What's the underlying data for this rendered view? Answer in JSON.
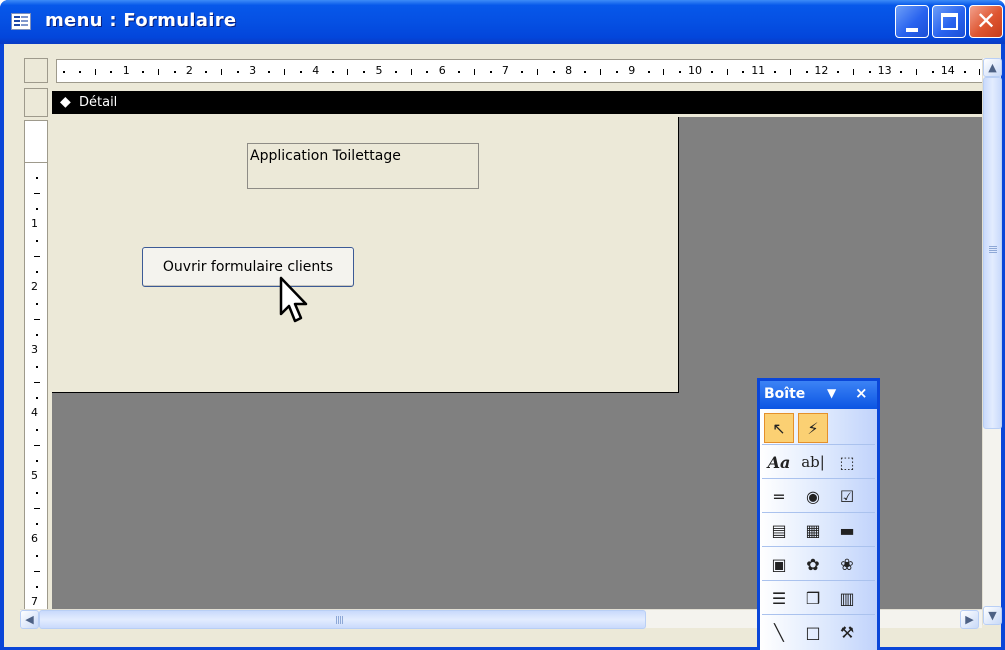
{
  "window": {
    "title": "menu : Formulaire"
  },
  "ruler": {
    "horizontal_labels": [
      "1",
      "2",
      "3",
      "4",
      "5",
      "6",
      "7",
      "8",
      "9",
      "10",
      "11",
      "12",
      "13",
      "14"
    ],
    "vertical_labels": [
      "1",
      "2",
      "3",
      "4",
      "5",
      "6",
      "7"
    ]
  },
  "section": {
    "label": "Détail",
    "arrow": "◆"
  },
  "form": {
    "label_text": "Application Toilettage",
    "button_text": "Ouvrir formulaire clients"
  },
  "toolbox": {
    "title": "Boîte",
    "dropdown_glyph": "▼",
    "close_glyph": "×",
    "tools": [
      {
        "name": "select-objects-icon",
        "glyph": "↖",
        "active": true
      },
      {
        "name": "control-wizards-icon",
        "glyph": "⚡",
        "active": true
      },
      {
        "name": "label-tool-icon",
        "glyph": "Aa",
        "active": false
      },
      {
        "name": "text-box-tool-icon",
        "glyph": "ab|",
        "active": false
      },
      {
        "name": "option-group-tool-icon",
        "glyph": "⬚",
        "active": false
      },
      {
        "name": "toggle-button-tool-icon",
        "glyph": "=",
        "active": false
      },
      {
        "name": "option-button-tool-icon",
        "glyph": "◉",
        "active": false
      },
      {
        "name": "check-box-tool-icon",
        "glyph": "☑",
        "active": false
      },
      {
        "name": "combo-box-tool-icon",
        "glyph": "▤",
        "active": false
      },
      {
        "name": "list-box-tool-icon",
        "glyph": "▦",
        "active": false
      },
      {
        "name": "command-button-tool-icon",
        "glyph": "▬",
        "active": false
      },
      {
        "name": "image-tool-icon",
        "glyph": "▣",
        "active": false
      },
      {
        "name": "unbound-object-frame-icon",
        "glyph": "✿",
        "active": false
      },
      {
        "name": "bound-object-frame-icon",
        "glyph": "❀",
        "active": false
      },
      {
        "name": "page-break-tool-icon",
        "glyph": "☰",
        "active": false
      },
      {
        "name": "tab-control-tool-icon",
        "glyph": "❒",
        "active": false
      },
      {
        "name": "subform-tool-icon",
        "glyph": "▥",
        "active": false
      },
      {
        "name": "line-tool-icon",
        "glyph": "╲",
        "active": false
      },
      {
        "name": "rectangle-tool-icon",
        "glyph": "□",
        "active": false
      },
      {
        "name": "more-controls-icon",
        "glyph": "⚒",
        "active": false
      }
    ]
  },
  "scrollbars": {
    "up_glyph": "▲",
    "down_glyph": "▼",
    "left_glyph": "◀",
    "right_glyph": "▶"
  }
}
